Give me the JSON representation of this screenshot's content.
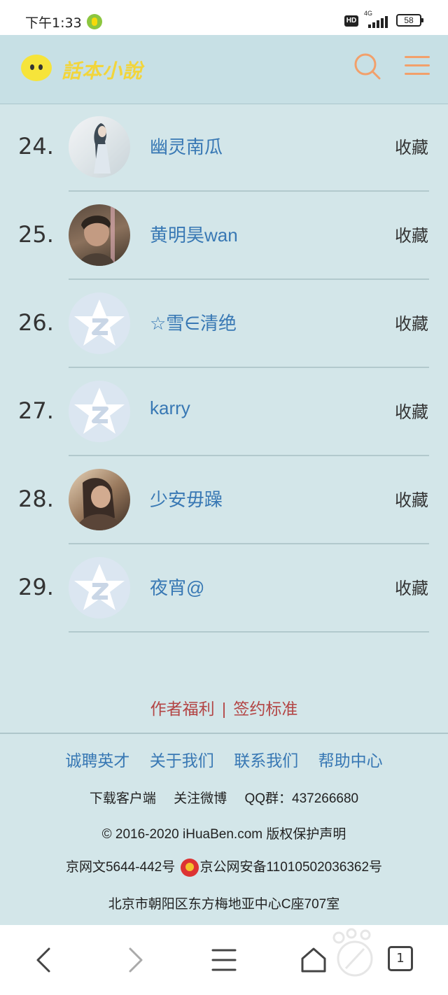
{
  "status_bar": {
    "time": "下午1:33",
    "hd": "HD",
    "network": "4G",
    "battery": "58"
  },
  "header": {
    "logo_text": "話本小說"
  },
  "list": {
    "rows": [
      {
        "rank": "24.",
        "name": "幽灵南瓜",
        "action": "收藏"
      },
      {
        "rank": "25.",
        "name": "黄明昊wan",
        "action": "收藏"
      },
      {
        "rank": "26.",
        "name": "☆雪∈清绝",
        "action": "收藏"
      },
      {
        "rank": "27.",
        "name": "karry",
        "action": "收藏"
      },
      {
        "rank": "28.",
        "name": "少安毋躁",
        "action": "收藏"
      },
      {
        "rank": "29.",
        "name": "夜宵@",
        "action": "收藏"
      }
    ]
  },
  "author_links": {
    "benefits": "作者福利",
    "separator": "|",
    "contract": "签约标准"
  },
  "footer": {
    "nav": [
      "诚聘英才",
      "关于我们",
      "联系我们",
      "帮助中心"
    ],
    "download": "下载客户端",
    "weibo": "关注微博",
    "qq_group": "QQ群：437266680",
    "copyright": "© 2016-2020 iHuaBen.com 版权保护声明",
    "icp": "京网文5644-442号",
    "police_record": "京公网安备11010502036362号",
    "address": "北京市朝阳区东方梅地亚中心C座707室"
  },
  "bottom_nav": {
    "tabs_count": "1"
  },
  "colors": {
    "background": "#d3e6e9",
    "header_bg": "#c7e0e5",
    "link_blue": "#3878b4",
    "accent_orange": "#f2a06b",
    "author_red": "#b34545"
  }
}
